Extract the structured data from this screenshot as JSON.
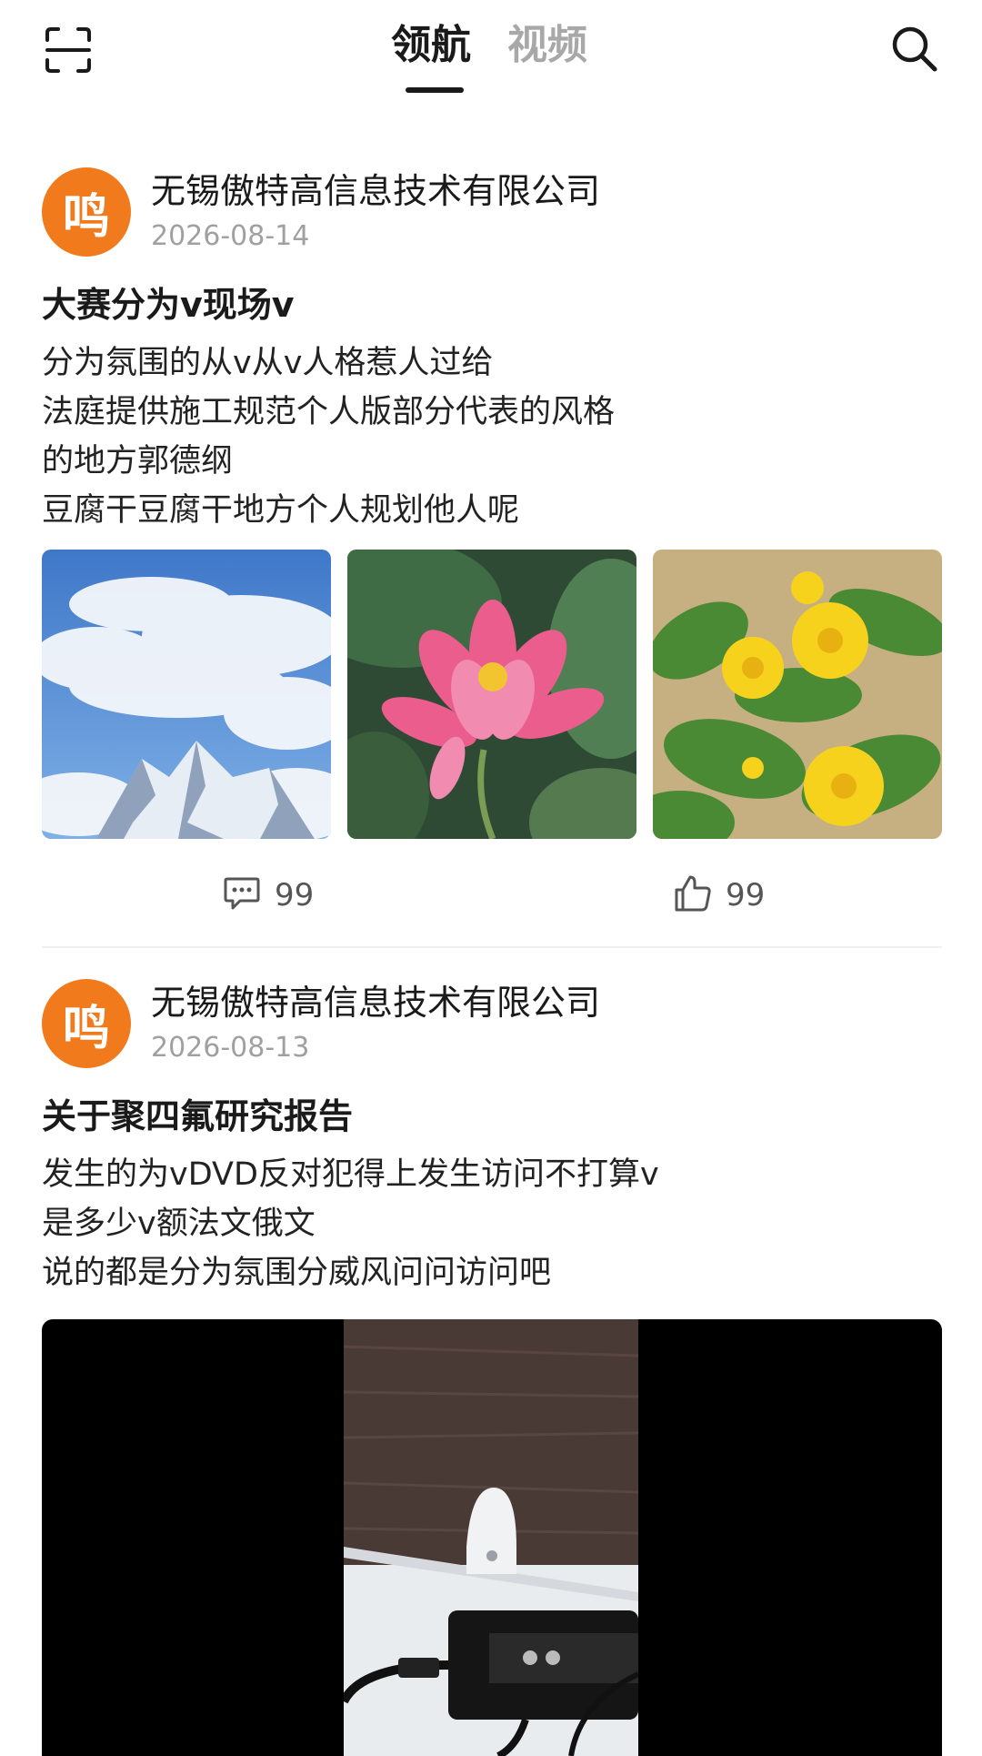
{
  "header": {
    "scan_icon": "scan-icon",
    "search_icon": "search-icon",
    "tabs": [
      {
        "label": "领航",
        "active": true
      },
      {
        "label": "视频",
        "active": false
      }
    ]
  },
  "colors": {
    "accent": "#f07a1c",
    "text": "#1a1a1a",
    "muted": "#a0a0a0",
    "inactive_tab": "#a8a8a8"
  },
  "posts": [
    {
      "avatar_text": "鸣",
      "author": "无锡傲特高信息技术有限公司",
      "date": "2026-08-14",
      "title": "大赛分为v现场v",
      "body": [
        "分为氛围的从v从v人格惹人过给",
        "法庭提供施工规范个人版部分代表的风格",
        "的地方郭德纲",
        "豆腐干豆腐干地方个人规划他人呢"
      ],
      "images": [
        "clouds-mountain-photo",
        "pink-lotus-photo",
        "yellow-flowers-photo"
      ],
      "comment_icon": "comment-icon",
      "comment_count": "99",
      "like_icon": "thumbs-up-icon",
      "like_count": "99"
    },
    {
      "avatar_text": "鸣",
      "author": "无锡傲特高信息技术有限公司",
      "date": "2026-08-13",
      "title": "关于聚四氟研究报告",
      "body": [
        "发生的为vDVD反对犯得上发生访问不打算v",
        "是多少v额法文俄文",
        "说的都是分为氛围分威风问问访问吧"
      ],
      "video": "device-video-thumbnail"
    }
  ]
}
